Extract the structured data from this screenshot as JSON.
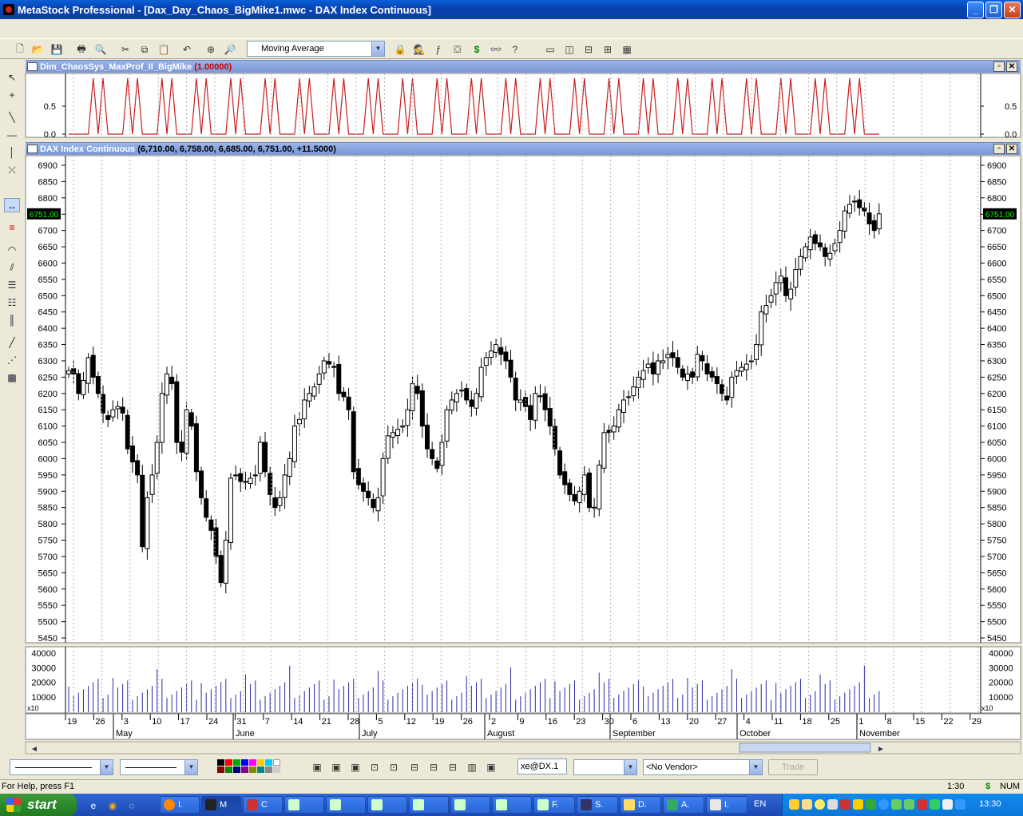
{
  "window": {
    "title": "MetaStock Professional - [Dax_Day_Chaos_BigMike1.mwc - DAX Index Continuous]",
    "minimize": "_",
    "restore": "❐",
    "close": "✕"
  },
  "toolbar": {
    "indicator_combo": "Moving Average",
    "dollar_icon_label": "$"
  },
  "indicator_pane": {
    "name": "Dim_ChaosSys_MaxProf_II_BigMike",
    "value": "(1.00000)",
    "y_ticks": [
      "0.5",
      "0.0"
    ]
  },
  "price_pane": {
    "name": "DAX Index Continuous",
    "ohlc": "(6,710.00, 6,758.00, 6,685.00, 6,751.00, +11.5000)",
    "last_price": "6751.00",
    "y_ticks": [
      "6900",
      "6850",
      "6800",
      "6750",
      "6700",
      "6650",
      "6600",
      "6550",
      "6500",
      "6450",
      "6400",
      "6350",
      "6300",
      "6250",
      "6200",
      "6150",
      "6100",
      "6050",
      "6000",
      "5950",
      "5900",
      "5850",
      "5800",
      "5750",
      "5700",
      "5650",
      "5600",
      "5550",
      "5500",
      "5450"
    ]
  },
  "volume_pane": {
    "y_ticks": [
      "40000",
      "30000",
      "20000",
      "10000"
    ],
    "multiplier": "x10"
  },
  "x_axis": {
    "day_labels": [
      "19",
      "26",
      "3",
      "10",
      "17",
      "24",
      "31",
      "7",
      "14",
      "21",
      "28",
      "5",
      "12",
      "19",
      "26",
      "2",
      "9",
      "16",
      "23",
      "30",
      "6",
      "13",
      "20",
      "27",
      "4",
      "11",
      "18",
      "25",
      "1",
      "8",
      "15",
      "22",
      "29"
    ],
    "month_labels": [
      "May",
      "June",
      "July",
      "August",
      "September",
      "October",
      "November"
    ]
  },
  "bottom_toolbar": {
    "security_field": "xe@DX.1",
    "vendor_combo": "<No Vendor>",
    "trade_button": "Trade"
  },
  "status": {
    "help": "For Help, press F1",
    "time": "1:30",
    "currency": "$",
    "num": "NUM"
  },
  "taskbar": {
    "start": "start",
    "items": [
      "I.",
      "M",
      "C",
      "F.",
      "S.",
      "D.",
      "A.",
      "I."
    ],
    "lang": "EN",
    "clock": "13:30"
  },
  "chart_data": {
    "type": "candlestick",
    "x": "trading days, 19 April to 17 November (day ticks as printed)",
    "ylim": [
      5450,
      6900
    ],
    "price_series_close": [
      6270,
      6260,
      6200,
      6240,
      6310,
      6250,
      6200,
      6140,
      6120,
      6150,
      6160,
      6140,
      6030,
      5990,
      5950,
      5730,
      5880,
      5950,
      6050,
      6200,
      6260,
      6230,
      6050,
      6020,
      6150,
      6100,
      5960,
      5880,
      5820,
      5780,
      5700,
      5620,
      5750,
      5940,
      5950,
      5930,
      5930,
      5940,
      5950,
      6050,
      5960,
      5890,
      5850,
      5880,
      5950,
      6000,
      6100,
      6120,
      6180,
      6200,
      6220,
      6260,
      6300,
      6290,
      6280,
      6200,
      6190,
      6150,
      5960,
      5920,
      5900,
      5880,
      5850,
      5880,
      6000,
      6070,
      6080,
      6090,
      6100,
      6150,
      6230,
      6200,
      6100,
      6030,
      6000,
      5970,
      6050,
      6150,
      6180,
      6200,
      6210,
      6180,
      6160,
      6200,
      6280,
      6310,
      6330,
      6350,
      6320,
      6300,
      6250,
      6180,
      6180,
      6160,
      6120,
      6200,
      6190,
      6150,
      6100,
      6030,
      5950,
      5920,
      5890,
      5870,
      5900,
      5950,
      5850,
      5850,
      5980,
      6080,
      6080,
      6100,
      6150,
      6180,
      6190,
      6220,
      6250,
      6270,
      6290,
      6260,
      6300,
      6300,
      6320,
      6310,
      6280,
      6250,
      6260,
      6250,
      6320,
      6300,
      6260,
      6250,
      6230,
      6200,
      6180,
      6250,
      6270,
      6280,
      6290,
      6300,
      6350,
      6450,
      6470,
      6500,
      6540,
      6560,
      6500,
      6520,
      6580,
      6620,
      6650,
      6680,
      6660,
      6650,
      6620,
      6630,
      6660,
      6700,
      6760,
      6780,
      6790,
      6770,
      6760,
      6720,
      6700,
      6751
    ],
    "volume_scale": "x10",
    "volume_ylim": [
      0,
      40000
    ],
    "indicator_ylim": [
      0,
      1
    ]
  }
}
